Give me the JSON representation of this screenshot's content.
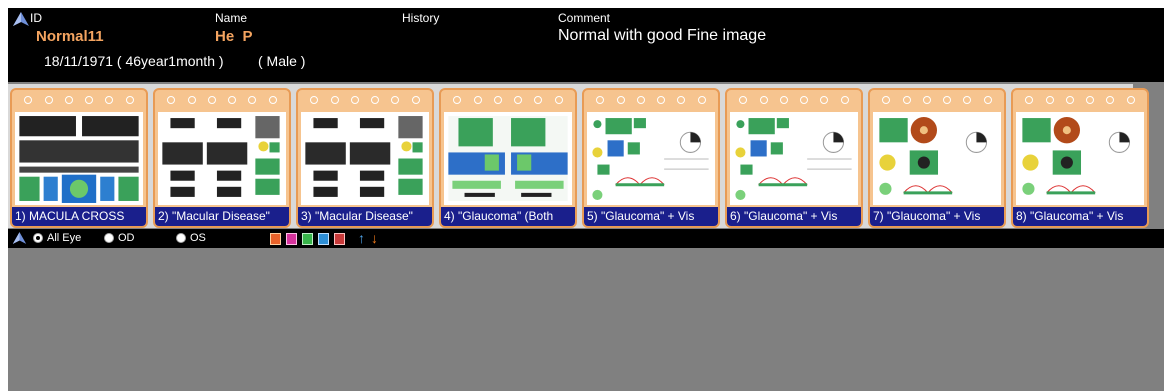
{
  "patient": {
    "id_label": "ID",
    "id_value": "Normal11",
    "name_label": "Name",
    "name_value": "He  P",
    "history_label": "History",
    "comment_label": "Comment",
    "comment_value": "Normal with good Fine image",
    "dob_line": "18/11/1971 ( 46year1month )",
    "sex": "( Male )"
  },
  "reports": [
    {
      "label": "1) MACULA CROSS",
      "kind": "macula-cross"
    },
    {
      "label": "2) \"Macular Disease\"",
      "kind": "macular-disease"
    },
    {
      "label": "3) \"Macular Disease\"",
      "kind": "macular-disease"
    },
    {
      "label": "4) \"Glaucoma\" (Both",
      "kind": "glaucoma-both"
    },
    {
      "label": "5) \"Glaucoma\" + Vis",
      "kind": "glaucoma-vis"
    },
    {
      "label": "6) \"Glaucoma\" + Vis",
      "kind": "glaucoma-vis"
    },
    {
      "label": "7) \"Glaucoma\" + Vis",
      "kind": "glaucoma-fundus"
    },
    {
      "label": "8) \"Glaucoma\" + Vis",
      "kind": "glaucoma-fundus"
    }
  ],
  "toolbar": {
    "all_eye_label": "All Eye",
    "od_label": "OD",
    "os_label": "OS",
    "selected_eye": "All Eye",
    "tool_icons": [
      "export-icon",
      "pink-report-icon",
      "green-report-icon",
      "blue-report-icon",
      "delete-icon"
    ],
    "tool_colors": [
      "#e8622a",
      "#d6339c",
      "#38b44a",
      "#2e8fd6",
      "#c83a3a"
    ],
    "up_arrow_color": "#4fa3e8",
    "down_arrow_color": "#f07a1a"
  },
  "colors": {
    "accent_name": "#f4a460",
    "label_bar": "#1a1f8c",
    "card_border": "#e89b55"
  }
}
